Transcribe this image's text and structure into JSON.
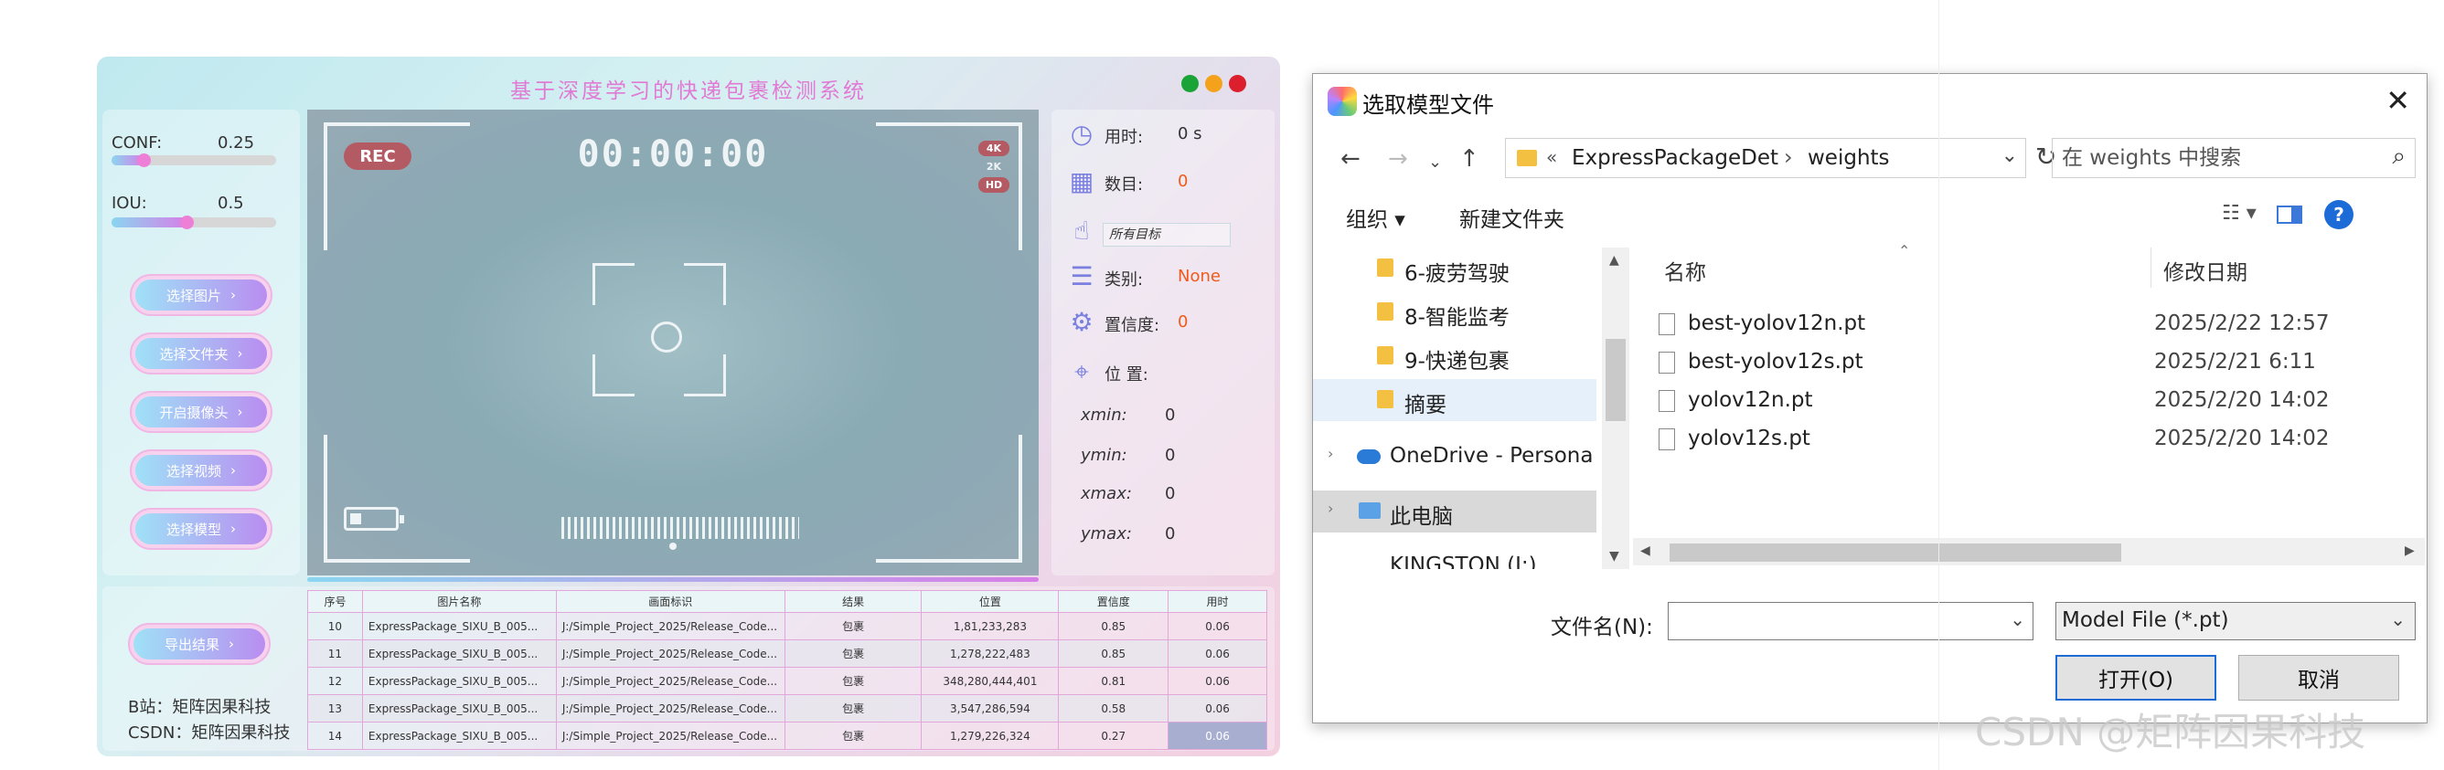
{
  "app": {
    "title": "基于深度学习的快递包裹检测系统",
    "conf_label": "CONF:",
    "conf_value": "0.25",
    "conf_fraction": 0.25,
    "iou_label": "IOU:",
    "iou_value": "0.5",
    "iou_fraction": 0.5,
    "buttons": [
      "选择图片",
      "选择文件夹",
      "开启摄像头",
      "选择视频",
      "选择模型"
    ],
    "export_button": "导出结果",
    "credit_bilibili": "B站：矩阵因果科技",
    "credit_csdn": "CSDN：矩阵因果科技"
  },
  "video": {
    "rec_label": "REC",
    "timer": "00:00:00",
    "res_4k": "4K",
    "res_2k": "2K",
    "res_hd": "HD"
  },
  "info": {
    "time_label": "用时:",
    "time_value": "0 s",
    "count_label": "数目:",
    "count_value": "0",
    "target_select": "所有目标",
    "class_label": "类别:",
    "class_value": "None",
    "conf_label": "置信度:",
    "conf_value": "0",
    "pos_label": "位 置:",
    "coords": [
      {
        "label": "xmin:",
        "value": "0"
      },
      {
        "label": "ymin:",
        "value": "0"
      },
      {
        "label": "xmax:",
        "value": "0"
      },
      {
        "label": "ymax:",
        "value": "0"
      }
    ],
    "value_color": "#f05a1a"
  },
  "table": {
    "headers": [
      "序号",
      "图片名称",
      "画面标识",
      "结果",
      "位置",
      "置信度",
      "用时"
    ],
    "rows": [
      [
        "10",
        "ExpressPackage_SIXU_B_005...",
        "J:/Simple_Project_2025/Release_Code...",
        "包裹",
        "1,81,233,283",
        "0.85",
        "0.06"
      ],
      [
        "11",
        "ExpressPackage_SIXU_B_005...",
        "J:/Simple_Project_2025/Release_Code...",
        "包裹",
        "1,278,222,483",
        "0.85",
        "0.06"
      ],
      [
        "12",
        "ExpressPackage_SIXU_B_005...",
        "J:/Simple_Project_2025/Release_Code...",
        "包裹",
        "348,280,444,401",
        "0.81",
        "0.06"
      ],
      [
        "13",
        "ExpressPackage_SIXU_B_005...",
        "J:/Simple_Project_2025/Release_Code...",
        "包裹",
        "3,547,286,594",
        "0.58",
        "0.06"
      ],
      [
        "14",
        "ExpressPackage_SIXU_B_005...",
        "J:/Simple_Project_2025/Release_Code...",
        "包裹",
        "1,279,226,324",
        "0.27",
        "0.06"
      ]
    ]
  },
  "dialog": {
    "title": "选取模型文件",
    "address_sep": "«",
    "address_parts": [
      "ExpressPackageDet",
      "weights"
    ],
    "search_placeholder": "在 weights 中搜索",
    "organize": "组织 ▾",
    "new_folder": "新建文件夹",
    "nav_items": [
      {
        "label": "6-疲劳驾驶",
        "type": "folder"
      },
      {
        "label": "8-智能监考",
        "type": "folder"
      },
      {
        "label": "9-快递包裹",
        "type": "folder"
      },
      {
        "label": "摘要",
        "type": "folder"
      },
      {
        "label": "OneDrive - Persona",
        "type": "cloud"
      },
      {
        "label": "此电脑",
        "type": "pc"
      },
      {
        "label": "KINGSTON (J:)",
        "type": "drive"
      }
    ],
    "col_name": "名称",
    "col_date": "修改日期",
    "files": [
      {
        "name": "best-yolov12n.pt",
        "date": "2025/2/22 12:57"
      },
      {
        "name": "best-yolov12s.pt",
        "date": "2025/2/21 6:11"
      },
      {
        "name": "yolov12n.pt",
        "date": "2025/2/20 14:02"
      },
      {
        "name": "yolov12s.pt",
        "date": "2025/2/20 14:02"
      }
    ],
    "filename_label": "文件名(N):",
    "filename_value": "",
    "filetype": "Model File (*.pt)",
    "open_button": "打开(O)",
    "cancel_button": "取消"
  },
  "watermark": "CSDN @矩阵因果科技"
}
